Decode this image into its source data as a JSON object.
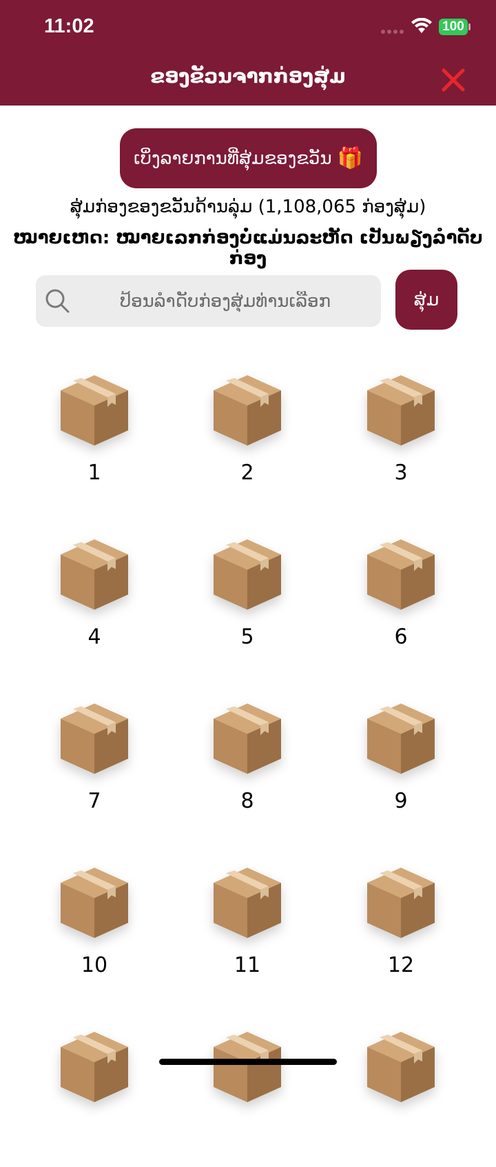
{
  "status_bar": {
    "time": "11:02",
    "battery": "100"
  },
  "header": {
    "title": "ຂອງຂັວນຈາກກ່ອງສຸ່ມ",
    "close_icon": "close-icon"
  },
  "history_button": {
    "label": "ເບິ່ງລາຍການທີ່ສຸ່ມຂອງຂວັນ",
    "icon": "🎁"
  },
  "info": {
    "line": "ສຸ່ມກ່ອງຂອງຂວັນດ້ານລຸ່ມ (1,108,065 ກ່ອງສຸ່ມ)",
    "note": "ໝາຍເຫດ: ໝາຍເລກກ່ອງບໍ່ແມ່ນລະຫັດ ເປັນພຽງລຳດັບກ່ອງ"
  },
  "search": {
    "placeholder": "ປ້ອນລຳດັບກ່ອງສຸ່ມທ່ານເລືອກ",
    "value": ""
  },
  "random_button": {
    "label": "ສຸ່ມ"
  },
  "boxes": [
    "1",
    "2",
    "3",
    "4",
    "5",
    "6",
    "7",
    "8",
    "9",
    "10",
    "11",
    "12",
    "",
    "",
    ""
  ],
  "colors": {
    "accent": "#7d1a36",
    "close": "#e8262d",
    "battery": "#34c759"
  }
}
